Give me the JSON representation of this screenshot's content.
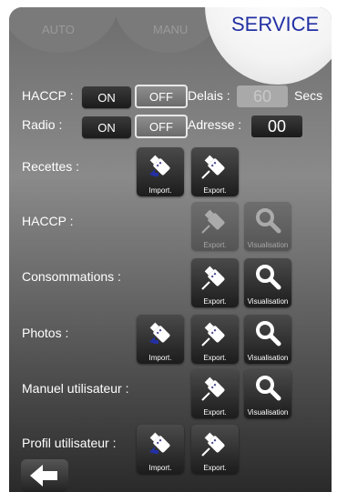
{
  "tabs": {
    "auto": "AUTO",
    "manu": "MANU",
    "service": "SERVICE"
  },
  "haccp_toggle": {
    "label": "HACCP :",
    "on": "ON",
    "off": "OFF"
  },
  "radio_toggle": {
    "label": "Radio :",
    "on": "ON",
    "off": "OFF"
  },
  "delais": {
    "label": "Delais :",
    "value": "60",
    "unit": "Secs"
  },
  "adresse": {
    "label": "Adresse :",
    "value": "00"
  },
  "sections": {
    "recettes": {
      "label": "Recettes :",
      "import": "Import.",
      "export": "Export."
    },
    "haccp": {
      "label": "HACCP :",
      "export": "Export.",
      "visu": "Visualisation"
    },
    "consommations": {
      "label": "Consommations :",
      "export": "Export.",
      "visu": "Visualisation"
    },
    "photos": {
      "label": "Photos :",
      "import": "Import.",
      "export": "Export.",
      "visu": "Visualisation"
    },
    "manuel": {
      "label": "Manuel utilisateur :",
      "export": "Export.",
      "visu": "Visualisation"
    },
    "profil": {
      "label": "Profil utilisateur :",
      "import": "Import.",
      "export": "Export."
    }
  },
  "icons": {
    "import": "usb-import-icon",
    "export": "usb-export-icon",
    "visu": "magnifier-icon",
    "back": "back-arrow-icon"
  },
  "colors": {
    "service_text": "#2330a3"
  }
}
